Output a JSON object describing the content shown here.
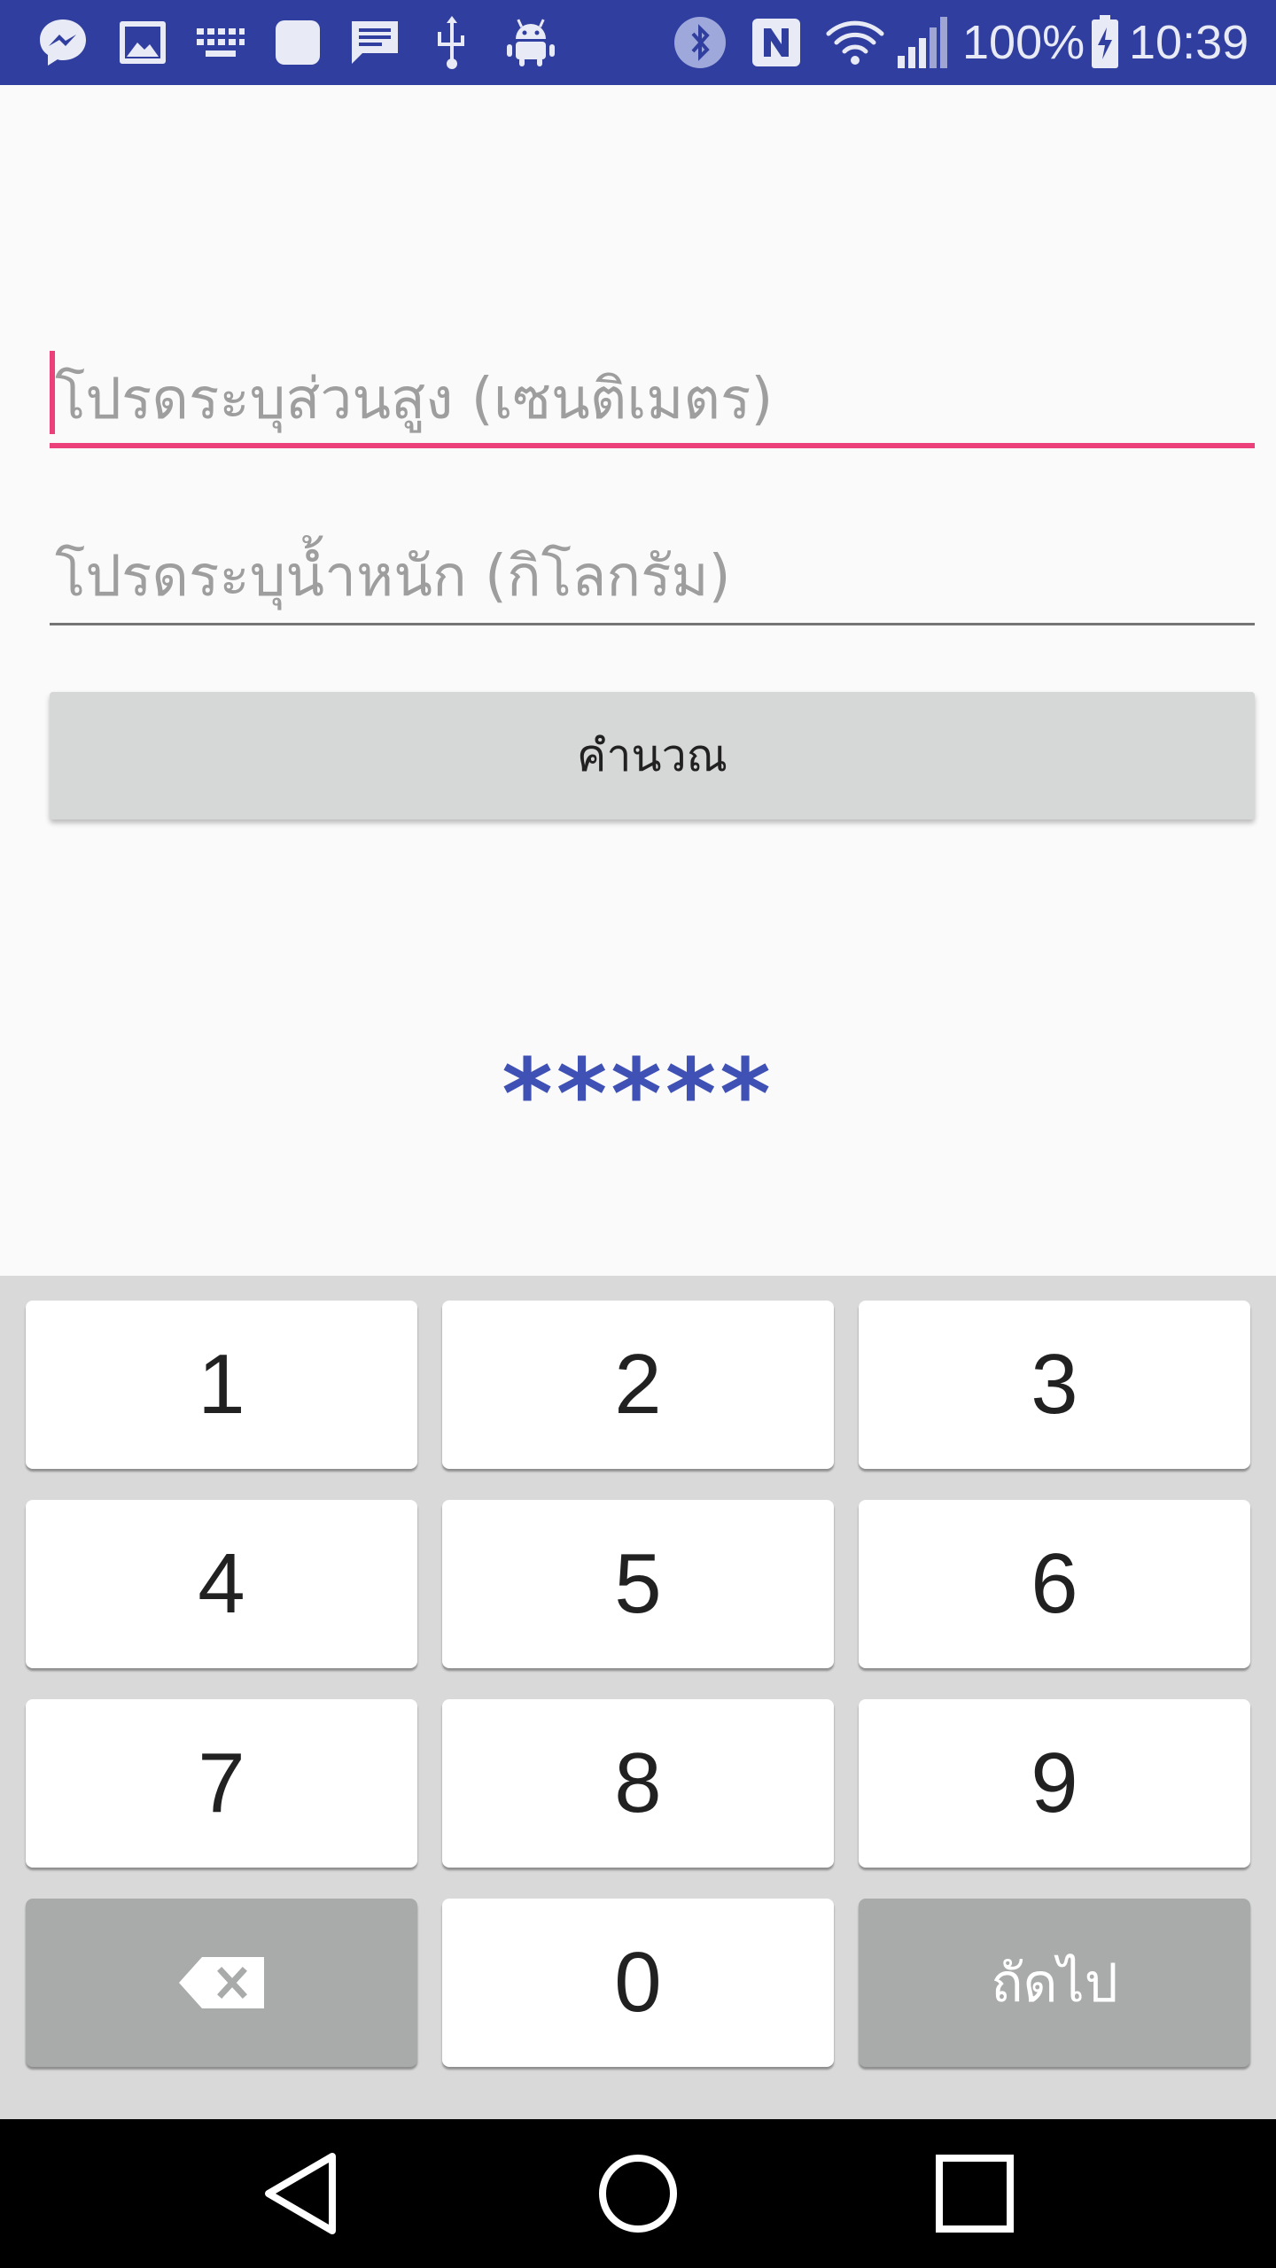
{
  "status_bar": {
    "icons": [
      "messenger-icon",
      "gallery-icon",
      "keyboard-icon",
      "app-icon",
      "message-icon",
      "usb-icon",
      "android-debug-icon",
      "bluetooth-icon",
      "nfc-icon",
      "wifi-icon",
      "signal-icon",
      "battery-charging-icon"
    ],
    "battery": "100%",
    "time": "10:39"
  },
  "form": {
    "height_placeholder": "โปรดระบุส่วนสูง (เซนติเมตร)",
    "height_value": "",
    "weight_placeholder": "โปรดระบุน้ำหนัก (กิโลกรัม)",
    "weight_value": "",
    "calculate_label": "คำนวณ",
    "result_text": "*****"
  },
  "colors": {
    "status_bar": "#303f9f",
    "accent": "#ec407a",
    "result": "#3f51b5"
  },
  "keyboard": {
    "keys": [
      "1",
      "2",
      "3",
      "4",
      "5",
      "6",
      "7",
      "8",
      "9",
      "0"
    ],
    "backspace_icon": "backspace-icon",
    "next_label": "ถัดไป"
  },
  "nav_bar": {
    "icons": [
      "back-icon",
      "home-icon",
      "recents-icon"
    ]
  }
}
